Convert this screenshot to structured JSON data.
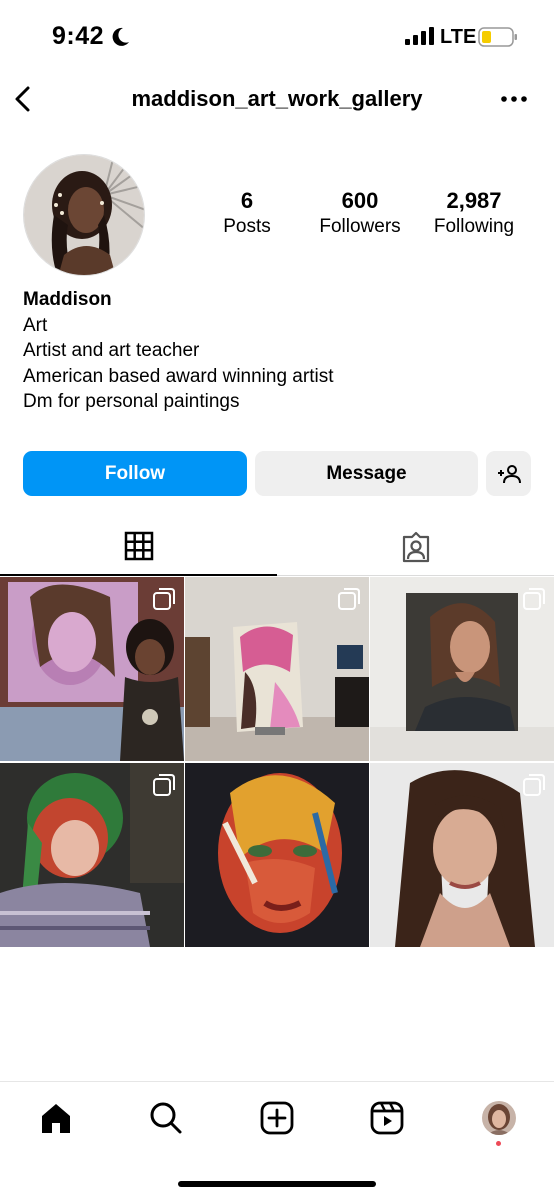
{
  "status_bar": {
    "time": "9:42",
    "network": "LTE",
    "icons": [
      "moon-icon",
      "signal-icon",
      "battery-icon"
    ]
  },
  "header": {
    "username": "maddison_art_work_gallery",
    "icons": [
      "back-arrow-icon",
      "more-options-icon"
    ]
  },
  "profile": {
    "stats": [
      {
        "value": "6",
        "label": "Posts"
      },
      {
        "value": "600",
        "label": "Followers"
      },
      {
        "value": "2,987",
        "label": "Following"
      }
    ],
    "name": "Maddison",
    "bio_lines": [
      "Art",
      "Artist and art teacher",
      "American based award winning artist",
      "Dm for personal paintings"
    ]
  },
  "actions": {
    "follow_label": "Follow",
    "message_label": "Message",
    "add_user_icon": "add-user-icon"
  },
  "tabs": [
    {
      "name": "posts-grid",
      "icon": "grid-icon",
      "active": true
    },
    {
      "name": "tagged",
      "icon": "tagged-person-icon",
      "active": false
    }
  ],
  "posts": [
    {
      "subject": "painting-with-artist",
      "multiple": true
    },
    {
      "subject": "canvas-in-studio",
      "multiple": true
    },
    {
      "subject": "portrait-painting",
      "multiple": true
    },
    {
      "subject": "selfie-green-hood",
      "multiple": true
    },
    {
      "subject": "colorful-face-painting",
      "multiple": false
    },
    {
      "subject": "portrait-photo",
      "multiple": true
    }
  ],
  "bottom_nav": [
    "home-icon",
    "search-icon",
    "create-icon",
    "reels-icon",
    "profile-avatar"
  ],
  "colors": {
    "follow_button": "#0095f6",
    "secondary_button": "#efefef",
    "notification_dot": "#ed4956"
  }
}
